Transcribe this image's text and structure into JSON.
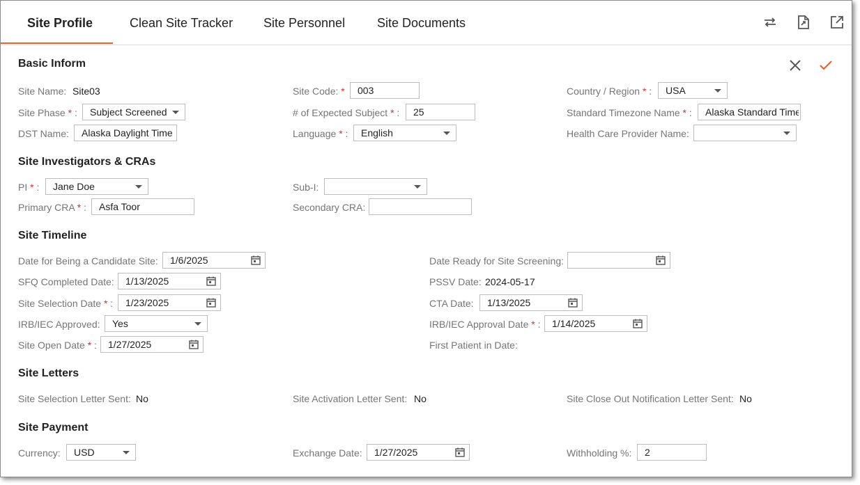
{
  "tabs": [
    "Site Profile",
    "Clean Site Tracker",
    "Site Personnel",
    "Site Documents"
  ],
  "header_icons": [
    "swap-icon",
    "export-document-icon",
    "open-external-icon"
  ],
  "actions": {
    "cancel": "close-icon",
    "save": "checkmark-icon"
  },
  "colors": {
    "accent": "#e8642c",
    "required": "#d32f2f",
    "label": "#757575"
  },
  "basic": {
    "title": "Basic Inform",
    "site_name_label": "Site Name:",
    "site_name": "Site03",
    "site_code_label": "Site Code:",
    "site_code": "003",
    "country_label": "Country / Region",
    "country": "USA",
    "phase_label": "Site Phase",
    "phase": "Subject Screened",
    "expected_label": "# of Expected Subject",
    "expected": "25",
    "timezone_label": "Standard Timezone Name",
    "timezone": "Alaska Standard Time",
    "dst_label": "DST Name:",
    "dst": "Alaska Daylight Time",
    "language_label": "Language",
    "language": "English",
    "hcp_label": "Health Care Provider Name:",
    "hcp": ""
  },
  "investigators": {
    "title": "Site Investigators & CRAs",
    "pi_label": "PI",
    "pi": "Jane Doe",
    "subi_label": "Sub-I:",
    "subi": "",
    "primary_cra_label": "Primary CRA",
    "primary_cra": "Asfa Toor",
    "secondary_cra_label": "Secondary CRA:",
    "secondary_cra": ""
  },
  "timeline": {
    "title": "Site Timeline",
    "candidate_label": "Date for Being a Candidate Site:",
    "candidate": "1/6/2025",
    "ready_label": "Date Ready for Site Screening:",
    "ready": "",
    "sfq_label": "SFQ Completed Date:",
    "sfq": "1/13/2025",
    "pssv_label": "PSSV Date:",
    "pssv": "2024-05-17",
    "selection_label": "Site Selection Date",
    "selection": "1/23/2025",
    "cta_label": "CTA Date:",
    "cta": "1/13/2025",
    "irb_label": "IRB/IEC Approved:",
    "irb": "Yes",
    "irb_date_label": "IRB/IEC Approval Date",
    "irb_date": "1/14/2025",
    "open_label": "Site Open Date",
    "open": "1/27/2025",
    "first_patient_label": "First Patient in Date:"
  },
  "letters": {
    "title": "Site Letters",
    "selection_label": "Site Selection Letter Sent:",
    "selection": "No",
    "activation_label": "Site Activation Letter Sent:",
    "activation": "No",
    "closeout_label": "Site Close Out Notification Letter Sent:",
    "closeout": "No"
  },
  "payment": {
    "title": "Site Payment",
    "currency_label": "Currency:",
    "currency": "USD",
    "exchange_label": "Exchange Date:",
    "exchange": "1/27/2025",
    "withholding_label": "Withholding %:",
    "withholding": "2"
  }
}
